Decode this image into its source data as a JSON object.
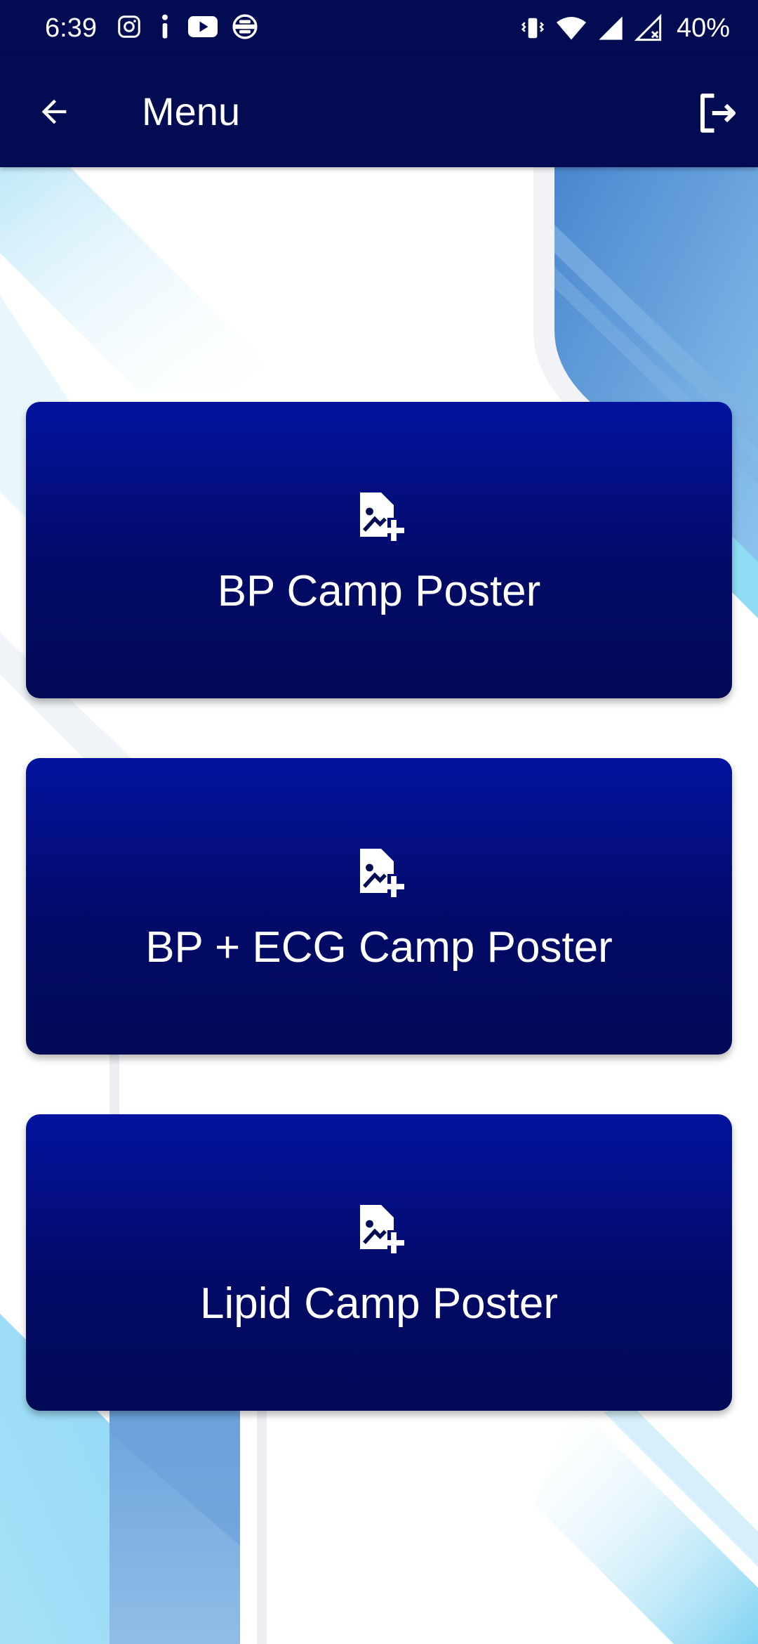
{
  "status_bar": {
    "time": "6:39",
    "battery": "40%",
    "left_icons": [
      "instagram-icon",
      "info-icon",
      "youtube-icon",
      "vpn-icon"
    ],
    "right_icons": [
      "vibrate-icon",
      "wifi-icon",
      "signal-icon",
      "signal-no-data-icon"
    ]
  },
  "app_bar": {
    "title": "Menu",
    "back_icon": "arrow-back-icon",
    "logout_icon": "logout-icon"
  },
  "menu": {
    "items": [
      {
        "label": "BP Camp Poster",
        "icon": "add-photo-file-icon"
      },
      {
        "label": "BP + ECG Camp Poster",
        "icon": "add-photo-file-icon"
      },
      {
        "label": "Lipid Camp Poster",
        "icon": "add-photo-file-icon"
      }
    ]
  },
  "colors": {
    "bar_background": "#030b52",
    "card_gradient_top": "#03139e",
    "card_gradient_bottom": "#020955",
    "text": "#ffffff",
    "decor_blue": "#5b8fd0",
    "decor_light": "#8fdcf5"
  }
}
